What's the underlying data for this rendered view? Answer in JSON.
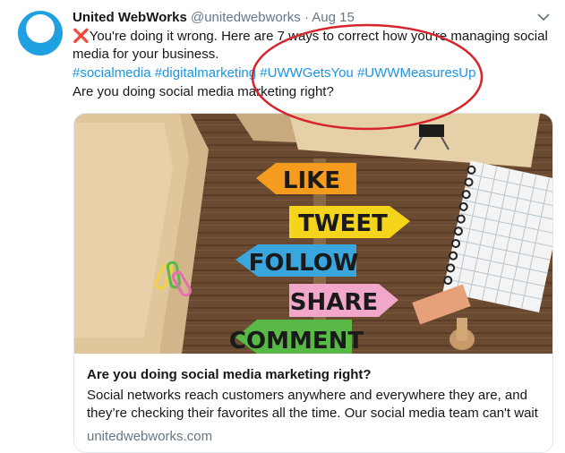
{
  "tweet": {
    "author_name": "United WebWorks",
    "handle": "@unitedwebworks",
    "separator": "·",
    "date": "Aug 15",
    "emoji": "❌",
    "line1": "You're doing it wrong. Here are 7 ways to correct how you're managing social media for your business.",
    "hashtags": [
      "#socialmedia",
      "#digitalmarketing",
      "#UWWGetsYou",
      "#UWWMeasuresUp"
    ],
    "line3": "Are you doing social media marketing right?"
  },
  "card": {
    "signs": [
      "LIKE",
      "TWEET",
      "FOLLOW",
      "SHARE",
      "COMMENT"
    ],
    "title": "Are you doing social media marketing right?",
    "description": "Social networks reach customers anywhere and everywhere they are, and they’re checking their favorites all the time. Our social media team can't wait",
    "domain": "unitedwebworks.com"
  },
  "colors": {
    "link": "#1b95e0",
    "muted": "#657786",
    "annotation": "#d6242d",
    "sign_like": "#f59b1e",
    "sign_tweet": "#f4d51c",
    "sign_follow": "#39a6dd",
    "sign_share": "#f0a7c9",
    "sign_comment": "#58b947"
  },
  "icons": {
    "avatar": "united-webworks-logo",
    "menu": "chevron-down-icon"
  }
}
